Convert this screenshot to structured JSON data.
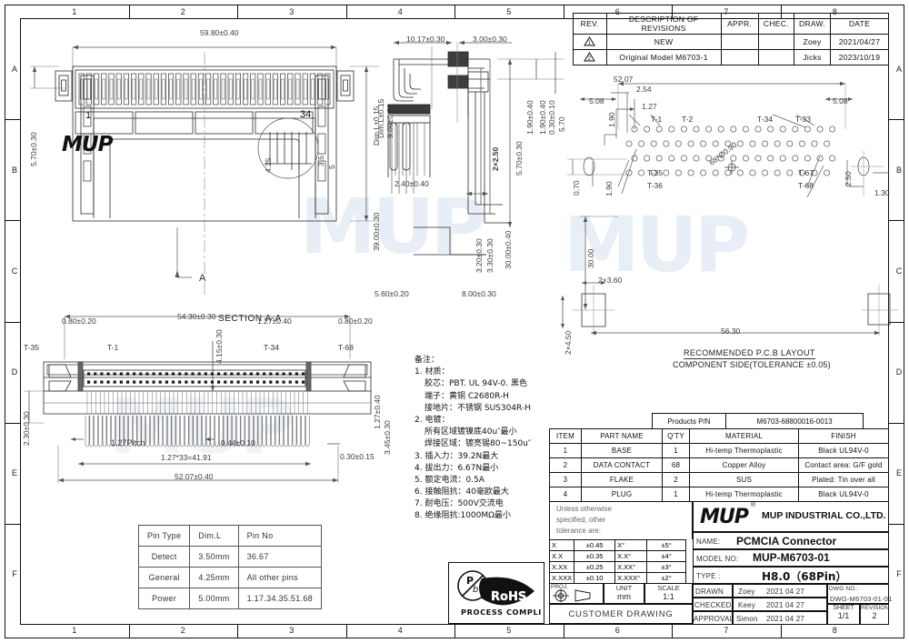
{
  "frame": {
    "columns": [
      "1",
      "2",
      "3",
      "4",
      "5",
      "6",
      "7",
      "8"
    ],
    "rows": [
      "A",
      "B",
      "C",
      "D",
      "E",
      "F"
    ]
  },
  "revision_table": {
    "headers": [
      "REV.",
      "DESCRIPTION OF REVISIONS",
      "APPR.",
      "CHEC.",
      "DRAW.",
      "DATE"
    ],
    "rows": [
      {
        "rev": "1",
        "desc": "NEW",
        "appr": "",
        "chec": "",
        "draw": "Zoey",
        "date": "2021/04/27"
      },
      {
        "rev": "2",
        "desc": "Original Model M6703-1",
        "appr": "",
        "chec": "",
        "draw": "Jicks",
        "date": "2023/10/19"
      }
    ]
  },
  "views": {
    "top_view": {
      "dims": [
        "59.80±0.40",
        "5.70±0.30",
        "39.00±0.30",
        "Dim.L±0.15",
        "4.25",
        "3.5",
        "5"
      ],
      "pin_marks": [
        "1",
        "34"
      ],
      "logo": "MUP",
      "section_mark": "A"
    },
    "side_view": {
      "dims": [
        "10.17±0.30",
        "3.00±0.30",
        "2×2.50",
        "2.40±0.40",
        "5.70±0.30",
        "30.00±0.40",
        "3.20±0.30",
        "3.30±0.30",
        "1.90±0.40",
        "1.90±0.40",
        "0.30±0.10",
        "5.70",
        "9.00±0.30",
        "Dim.L±0.15",
        "30.00",
        "8.00±0.30",
        "5.60±0.20"
      ]
    },
    "section_aa": {
      "title": "SECTION A-A",
      "dims": [
        "54.30±0.30",
        "0.80±0.20",
        "0.80±0.20",
        "1.27±0.40",
        "4.15±0.30",
        "2.30±0.30",
        "1.27±0.40",
        "3.45±0.30",
        "1.27Pitch",
        "0.44±0.10",
        "0.30±0.15",
        "1.27*33=41.91",
        "52.07±0.40"
      ],
      "pin_labels": [
        "T-35",
        "T-1",
        "T-34",
        "T-68"
      ]
    },
    "pcb_layout": {
      "title_line1": "RECOMMENDED P.C.B LAYOUT",
      "title_line2": "COMPONENT SIDE(TOLERANCE ±0.05)",
      "dims": [
        "52.07",
        "5.08",
        "2.54",
        "1.27",
        "1.90",
        "1.90",
        "0.70",
        "5.08",
        "2.50",
        "1.30",
        "68*Ø0.90",
        "2×3.60",
        "2×4.50",
        "56.30",
        "30.00"
      ],
      "pin_labels": [
        "T-1",
        "T-2",
        "T-34",
        "T-33",
        "T-35",
        "T-36",
        "T-67",
        "T-68"
      ]
    }
  },
  "notes": {
    "title": "备注：",
    "lines": [
      "1. 材质：",
      "胶芯：PBT. UL 94V-0. 黑色",
      "端子：黄铜 C2680R-H",
      "接地片：不锈钢 SUS304R-H",
      "2. 电镀：",
      "所有区域镀镍底40u″最小",
      "焊接区域：镀亮锡80~150u″",
      "3. 插入力：39.2N最大",
      "4. 拔出力：6.67N最小",
      "5. 额定电流：0.5A",
      "6. 接触阻抗：40毫欧最大",
      "7. 耐电压：500V交流电",
      "8. 绝缘阻抗:1000MΩ最小"
    ]
  },
  "pin_type_table": {
    "headers": [
      "Pin Type",
      "Dim.L",
      "Pin No"
    ],
    "rows": [
      [
        "Detect",
        "3.50mm",
        "36.67"
      ],
      [
        "General",
        "4.25mm",
        "All other pins"
      ],
      [
        "Power",
        "5.00mm",
        "1.17.34.35.51.68"
      ]
    ]
  },
  "products_pn": {
    "label": "Products P/N",
    "value": "M6703-68800016-0013"
  },
  "parts_table": {
    "headers": [
      "ITEM",
      "PART NAME",
      "Q'TY",
      "MATERIAL",
      "FINISH"
    ],
    "rows": [
      [
        "1",
        "BASE",
        "1",
        "Hi-temp Thermoplastic",
        "Black UL94V-0"
      ],
      [
        "2",
        "DATA CONTACT",
        "68",
        "Copper Alloy",
        "Contact area: G/F gold"
      ],
      [
        "3",
        "FLAKE",
        "2",
        "SUS",
        "Plated: Tin over all"
      ],
      [
        "4",
        "PLUG",
        "1",
        "Hi-temp Thermoplastic",
        "Black UL94V-0"
      ]
    ]
  },
  "tolerance_block": {
    "heading": [
      "Unless otherwise",
      "specified, other",
      "tolerance are:"
    ],
    "linear": [
      [
        "X",
        "±0.45"
      ],
      [
        "X.X",
        "±0.35"
      ],
      [
        "X.XX",
        "±0.25"
      ],
      [
        "X.XXX",
        "±0.10"
      ]
    ],
    "angular": [
      [
        "X°",
        "±5°"
      ],
      [
        "X.X°",
        "±4°"
      ],
      [
        "X.XX°",
        "±3°"
      ],
      [
        "X.XXX°",
        "±2°"
      ]
    ],
    "proj_label": "PROJ.",
    "unit_label": "UNIT",
    "unit_value": "mm",
    "scale_label": "SCALE",
    "scale_value": "1:1",
    "customer_drawing": "CUSTOMER DRAWING"
  },
  "title_block": {
    "logo_mark": "MUP",
    "registered": "®",
    "company": "MUP INDUSTRIAL CO.,LTD.",
    "name_label": "NAME:",
    "name_value": "PCMCIA  Connector",
    "model_label": "MODEL NO:",
    "model_value": "MUP-M6703-01",
    "type_label": "TYPE :",
    "type_value": "H8.0（68Pin）",
    "drawn_label": "DRAWN",
    "drawn_name": "Zoey",
    "drawn_date": "2021 04 27",
    "checked_label": "CHECKED",
    "checked_name": "Keey",
    "checked_date": "2021 04 27",
    "approval_label": "APPROVAL",
    "approval_name": "Simon",
    "approval_date": "2021 04 27",
    "dwg_label": "DWG NO.:",
    "dwg_value": "DWG-M6703-01-01",
    "sheet_label": "SHEET",
    "sheet_value": "1/1",
    "revision_label": "REVISION",
    "revision_value": "2"
  },
  "rohs": {
    "pb_mark": "Pb",
    "text": "RoHS",
    "sub": "PROCESS COMPLIANT"
  },
  "watermark": "MUP"
}
